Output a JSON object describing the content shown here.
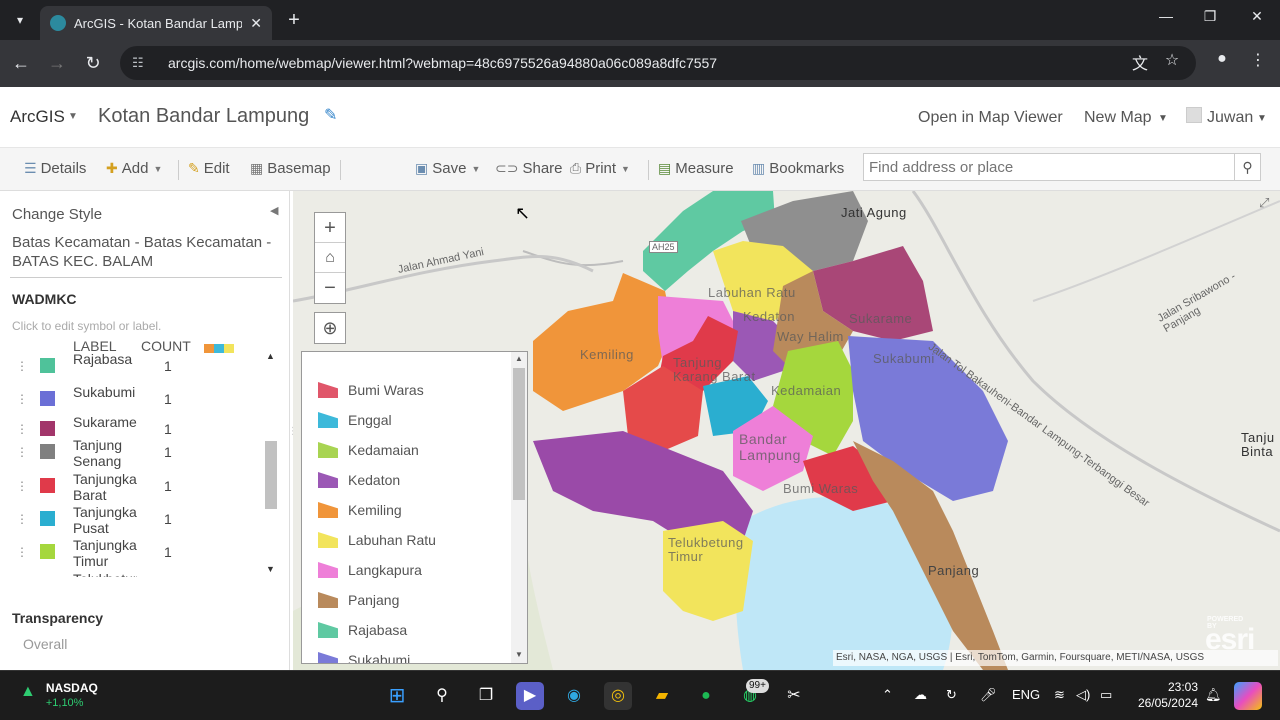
{
  "browser": {
    "tab_title": "ArcGIS - Kotan Bandar Lampung",
    "url": "arcgis.com/home/webmap/viewer.html?webmap=48c6975526a94880a06c089a8dfc7557"
  },
  "header": {
    "brand": "ArcGIS",
    "map_title": "Kotan Bandar Lampung",
    "open_in_map_viewer": "Open in Map Viewer",
    "new_map": "New Map",
    "user": "Juwan"
  },
  "toolbar": {
    "details": "Details",
    "add": "Add",
    "edit": "Edit",
    "basemap": "Basemap",
    "save": "Save",
    "share": "Share",
    "print": "Print",
    "measure": "Measure",
    "bookmarks": "Bookmarks",
    "search_placeholder": "Find address or place"
  },
  "panel": {
    "title": "Change Style",
    "layer_name": "Batas Kecamatan - Batas Kecamatan - BATAS KEC. BALAM",
    "field": "WADMKC",
    "hint": "Click to edit symbol or label.",
    "col_label": "LABEL",
    "col_count": "COUNT",
    "rows": [
      {
        "label": "Rajabasa",
        "count": "1",
        "color": "#4fc29a"
      },
      {
        "label": "Sukabumi",
        "count": "1",
        "color": "#6b6fd6"
      },
      {
        "label": "Sukarame",
        "count": "1",
        "color": "#a2356a"
      },
      {
        "label": "Tanjung Senang",
        "count": "1",
        "color": "#808080"
      },
      {
        "label": "Tanjungkarang Barat",
        "count": "1",
        "color": "#e03a4a"
      },
      {
        "label": "Tanjungkarang Pusat",
        "count": "1",
        "color": "#2aaed0"
      },
      {
        "label": "Tanjungkarang Timur",
        "count": "1",
        "color": "#a5d73d"
      },
      {
        "label": "Telukbetung",
        "count": "1",
        "color": "#9a4aa8"
      }
    ],
    "transparency": "Transparency",
    "overall": "Overall"
  },
  "legend": {
    "items": [
      {
        "label": "Bumi Waras",
        "color": "#e0566a"
      },
      {
        "label": "Enggal",
        "color": "#3db9da"
      },
      {
        "label": "Kedamaian",
        "color": "#a8d452"
      },
      {
        "label": "Kedaton",
        "color": "#9b58b5"
      },
      {
        "label": "Kemiling",
        "color": "#f0953a"
      },
      {
        "label": "Labuhan Ratu",
        "color": "#f2e45c"
      },
      {
        "label": "Langkapura",
        "color": "#ee7fd8"
      },
      {
        "label": "Panjang",
        "color": "#b98a5c"
      },
      {
        "label": "Rajabasa",
        "color": "#5fc9a2"
      },
      {
        "label": "Sukabumi",
        "color": "#7a7ad8"
      }
    ]
  },
  "map": {
    "labels": {
      "jati_agung": "Jati Agung",
      "labuhan_ratu": "Labuhan Ratu",
      "kedaton": "Kedaton",
      "sukarame": "Sukarame",
      "way_halim": "Way Halim",
      "kemiling": "Kemiling",
      "tanjung_karang_barat": "Tanjung Karang Barat",
      "sukabumi": "Sukabumi",
      "kedamaian": "Kedamaian",
      "bandar_lampung": "Bandar Lampung",
      "bumi_waras": "Bumi Waras",
      "telukbetung_timur": "Telukbetung Timur",
      "panjang": "Panjang",
      "tanjung_bintang": "Tanju Binta"
    },
    "roads": {
      "ahmad_yani": "Jalan Ahmad Yani",
      "tol": "Jalan Tol Bakauheni-Bandar Lampung-Terbanggi Besar",
      "sribawono": "Jalan Sribawono - Panjang",
      "ah25": "AH25"
    },
    "attribution": "Esri, NASA, NGA, USGS | Esri, TomTom, Garmin, Foursquare, METI/NASA, USGS",
    "esri_badge": "esri",
    "powered_by": "POWERED BY"
  },
  "taskbar": {
    "ticker_name": "NASDAQ",
    "ticker_value": "+1,10%",
    "lang": "ENG",
    "time": "23:03",
    "date": "26/05/2024",
    "whatsapp_badge": "99+"
  }
}
